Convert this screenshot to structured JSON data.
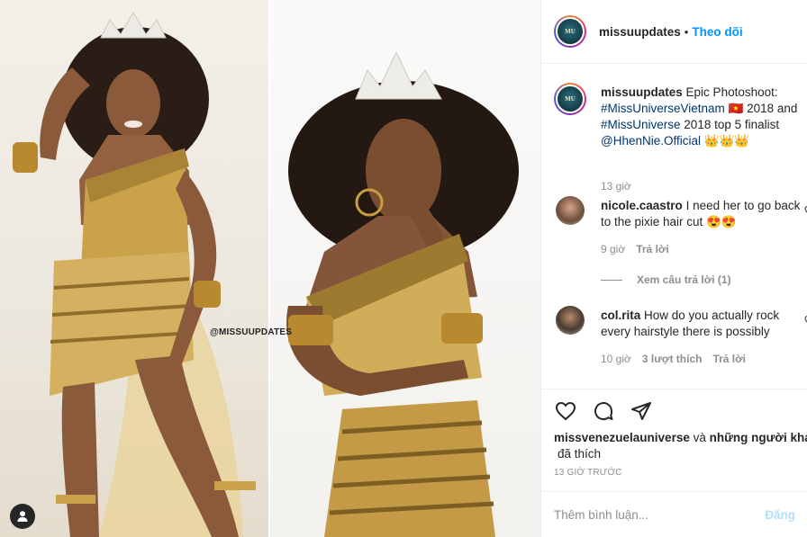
{
  "media": {
    "watermark": "@MISSUUPDATES"
  },
  "header": {
    "avatar_text": "MU",
    "username": "missuupdates",
    "separator": "•",
    "follow_label": "Theo dõi"
  },
  "caption": {
    "username": "missuupdates",
    "text_1": "Epic Photoshoot:",
    "hashtag_1": "#MissUniverseVietnam",
    "text_2": "🇻🇳 2018 and",
    "hashtag_2": "#MissUniverse",
    "text_3": "2018 top 5 finalist",
    "mention": "@HhenNie.Official",
    "text_4": "👑👑👑",
    "time": "13 giờ"
  },
  "comments": [
    {
      "username": "nicole.caastro",
      "text": "I need her to go back to the pixie hair cut 😍😍",
      "time": "9 giờ",
      "reply_label": "Trả lời",
      "view_replies": "Xem câu trả lời (1)"
    },
    {
      "username": "col.rita",
      "text": "How do you actually rock every hairstyle there is possibly",
      "time": "10 giờ",
      "likes": "3 lượt thích",
      "reply_label": "Trả lời"
    }
  ],
  "actions": {
    "liked_by_user": "missvenezuelauniverse",
    "liked_by_conj": "và",
    "liked_by_others": "những người khác",
    "liked_suffix": "đã thích",
    "post_time": "13 GIỜ TRƯỚC"
  },
  "add_comment": {
    "placeholder": "Thêm bình luận...",
    "post_label": "Đăng"
  },
  "colors": {
    "accent": "#0095f6",
    "link": "#00376b",
    "muted": "#8e8e8e",
    "gold": "#c9a24a"
  }
}
